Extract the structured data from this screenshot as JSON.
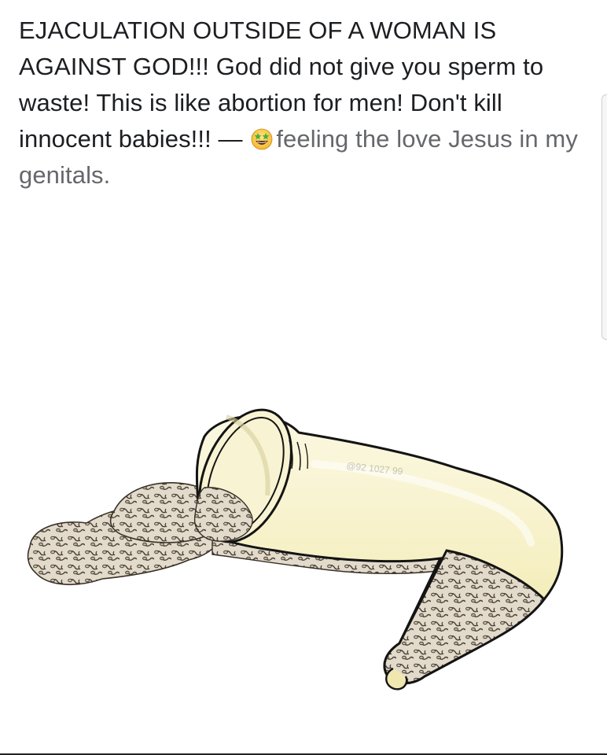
{
  "post": {
    "text": "EJACULATION OUTSIDE OF A WOMAN IS AGAINST GOD!!! God did not give you sperm to waste! This is like abortion for men! Don't kill innocent babies!!!",
    "separator": " — ",
    "feeling_emoji": "grinning-face-with-green-star-eyes",
    "feeling_text": "feeling the love Jesus in my genitals."
  },
  "illustration": {
    "subject": "spilled-condom-drawing",
    "colors": {
      "condom_fill": "#f6f1c8",
      "outline": "#1a1a1a",
      "spill_fill": "#d8cfc0"
    },
    "watermark": "@92 1027 99"
  },
  "colors": {
    "text": "#1c1e21",
    "feeling": "#65676b",
    "background": "#ffffff"
  }
}
